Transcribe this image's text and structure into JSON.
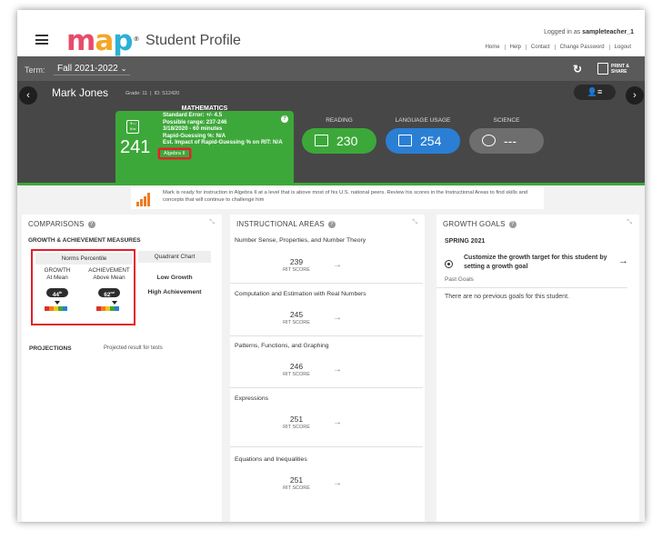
{
  "header": {
    "logo_text": [
      "m",
      "a",
      "p"
    ],
    "title": "Student Profile",
    "logged_in_prefix": "Logged in as",
    "username": "sampleteacher_1",
    "links": [
      "Home",
      "Help",
      "Contact",
      "Change Password",
      "Logout"
    ]
  },
  "termbar": {
    "label": "Term:",
    "term": "Fall 2021-2022",
    "print_label_1": "PRINT &",
    "print_label_2": "SHARE"
  },
  "student": {
    "name": "Mark Jones",
    "grade": "Grade: 11",
    "id": "ID: S12420"
  },
  "math": {
    "label": "MATHEMATICS",
    "score": "241",
    "details": [
      "Standard Error: +/- 4.5",
      "Possible range: 237-246",
      "3/18/2020 - 60 minutes",
      "Rapid-Guessing %: N/A",
      "Est. Impact of Rapid-Guessing % on RIT: N/A"
    ],
    "course": "Algebra II"
  },
  "subjects": [
    {
      "label": "READING",
      "value": "230",
      "color": "#3da83a"
    },
    {
      "label": "LANGUAGE USAGE",
      "value": "254",
      "color": "#2a7fd4"
    },
    {
      "label": "SCIENCE",
      "value": "---",
      "color": "#6e6e6e"
    }
  ],
  "message": "Mark is ready for instruction in Algebra II at a level that is above most of his U.S. national peers. Review his scores in the Instructional Areas to find skills and concepts that will continue to challenge him",
  "comparisons": {
    "title": "COMPARISONS",
    "section": "GROWTH & ACHIEVEMENT MEASURES",
    "norms_tab": "Norms Percentile",
    "quadrant_tab": "Quadrant Chart",
    "growth_head_1": "GROWTH",
    "growth_head_2": "At Mean",
    "growth_pct": "44",
    "growth_suffix": "th",
    "achieve_head_1": "ACHIEVEMENT",
    "achieve_head_2": "Above Mean",
    "achieve_pct": "62",
    "achieve_suffix": "nd",
    "quadrant_1": "Low Growth",
    "quadrant_2": "High Achievement",
    "projections": "PROJECTIONS",
    "projections_desc": "Projected result for tests",
    "scale_colors": [
      "#d9342b",
      "#f07c22",
      "#f5c518",
      "#3da83a",
      "#2a7fd4"
    ]
  },
  "instructional": {
    "title": "INSTRUCTIONAL AREAS",
    "score_label": "RIT SCORE",
    "areas": [
      {
        "name": "Number Sense, Properties, and Number Theory",
        "score": "239"
      },
      {
        "name": "Computation and Estimation with Real Numbers",
        "score": "245"
      },
      {
        "name": "Patterns, Functions, and Graphing",
        "score": "246"
      },
      {
        "name": "Expressions",
        "score": "251"
      },
      {
        "name": "Equations and Inequalities",
        "score": "251"
      }
    ]
  },
  "growth_goals": {
    "title": "GROWTH GOALS",
    "season": "SPRING 2021",
    "cta": "Customize the growth target for this student by setting a growth goal",
    "past_label": "Past Goals",
    "none_text": "There are no previous goals for this student."
  },
  "icons": {
    "menu": "hamburger-icon",
    "refresh": "refresh-icon",
    "print": "print-icon",
    "prev": "chevron-left-icon",
    "next": "chevron-right-icon",
    "math": "calculator-icon",
    "reading": "book-icon",
    "language": "pencil-icon",
    "science": "atom-icon",
    "message": "bar-chart-icon",
    "arrow": "arrow-right-icon",
    "target": "target-icon"
  }
}
